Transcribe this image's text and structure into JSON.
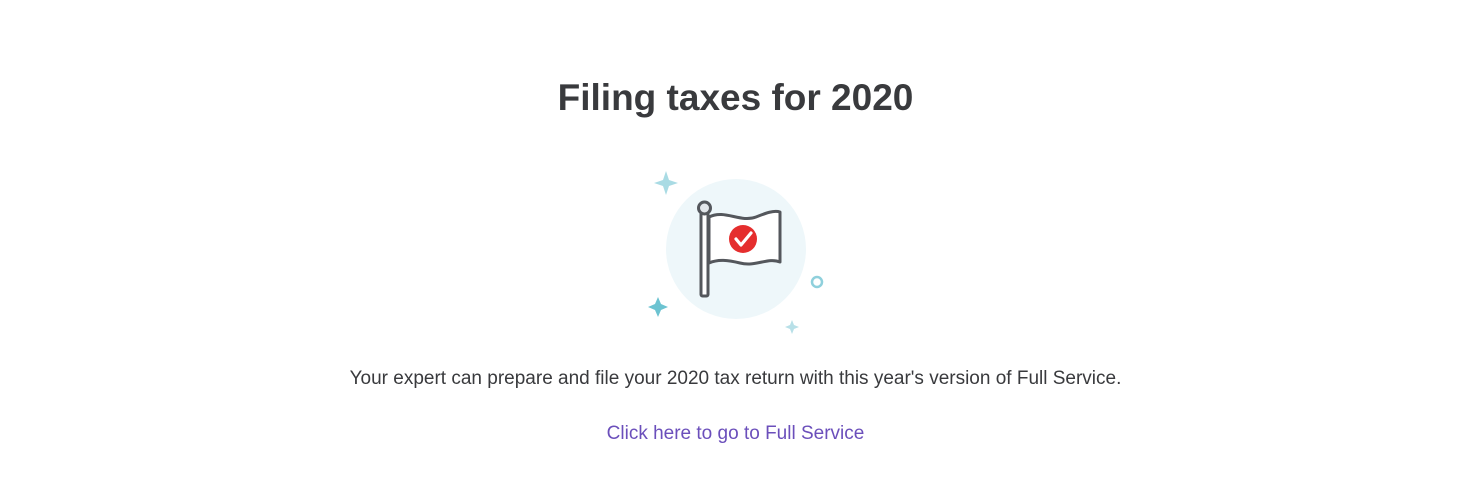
{
  "header": {
    "title": "Filing taxes for 2020"
  },
  "illustration": {
    "icon": "flag-check-icon",
    "decorations": [
      "sparkle-icon",
      "sparkle-icon",
      "sparkle-icon",
      "ring-icon"
    ],
    "colors": {
      "circle_bg": "#eef7fa",
      "sparkle": "#7ecbd8",
      "flag_outline": "#54575c",
      "check_badge": "#e52e2e"
    }
  },
  "main": {
    "description": "Your expert can prepare and file your 2020 tax return with this year's version of Full Service.",
    "link_label": "Click here to go to Full Service"
  },
  "colors": {
    "text": "#393a3d",
    "link": "#6b4fbb"
  }
}
